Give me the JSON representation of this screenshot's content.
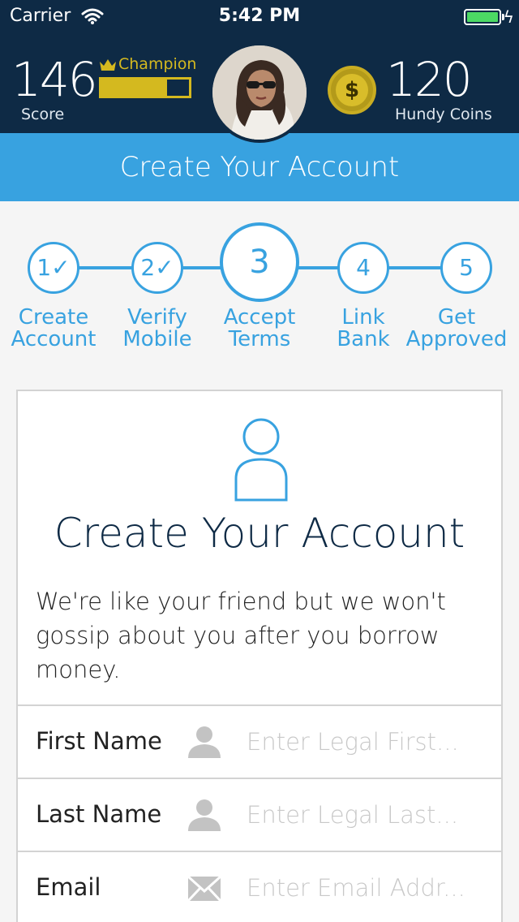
{
  "status_bar": {
    "carrier": "Carrier",
    "time": "5:42 PM",
    "battery_level": 1.0
  },
  "header": {
    "score_value": "146",
    "score_label": "Score",
    "rank_label": "Champion",
    "rank_progress": 0.75,
    "coins_value": "120",
    "coins_label": "Hundy Coins",
    "coin_symbol": "$"
  },
  "title_band": {
    "title": "Create Your Account"
  },
  "stepper": {
    "steps": [
      {
        "number": "1",
        "check": "✓",
        "line1": "Create",
        "line2": "Account",
        "state": "done"
      },
      {
        "number": "2",
        "check": "✓",
        "line1": "Verify",
        "line2": "Mobile",
        "state": "done"
      },
      {
        "number": "3",
        "check": "",
        "line1": "Accept",
        "line2": "Terms",
        "state": "current"
      },
      {
        "number": "4",
        "check": "",
        "line1": "Link",
        "line2": "Bank",
        "state": "upcoming"
      },
      {
        "number": "5",
        "check": "",
        "line1": "Get",
        "line2": "Approved",
        "state": "upcoming"
      }
    ]
  },
  "card": {
    "title": "Create Your Account",
    "subtitle": "We're like your friend but we won't gossip about you after you borrow money.",
    "fields": [
      {
        "label": "First Name",
        "placeholder": "Enter Legal First...",
        "icon": "person-icon"
      },
      {
        "label": "Last Name",
        "placeholder": "Enter Legal Last...",
        "icon": "person-icon"
      },
      {
        "label": "Email",
        "placeholder": "Enter Email Addr...",
        "icon": "mail-icon"
      }
    ]
  },
  "colors": {
    "navy": "#0e2a45",
    "accent_blue": "#38a2e0",
    "gold": "#d4b91f",
    "battery_green": "#4cd964"
  }
}
